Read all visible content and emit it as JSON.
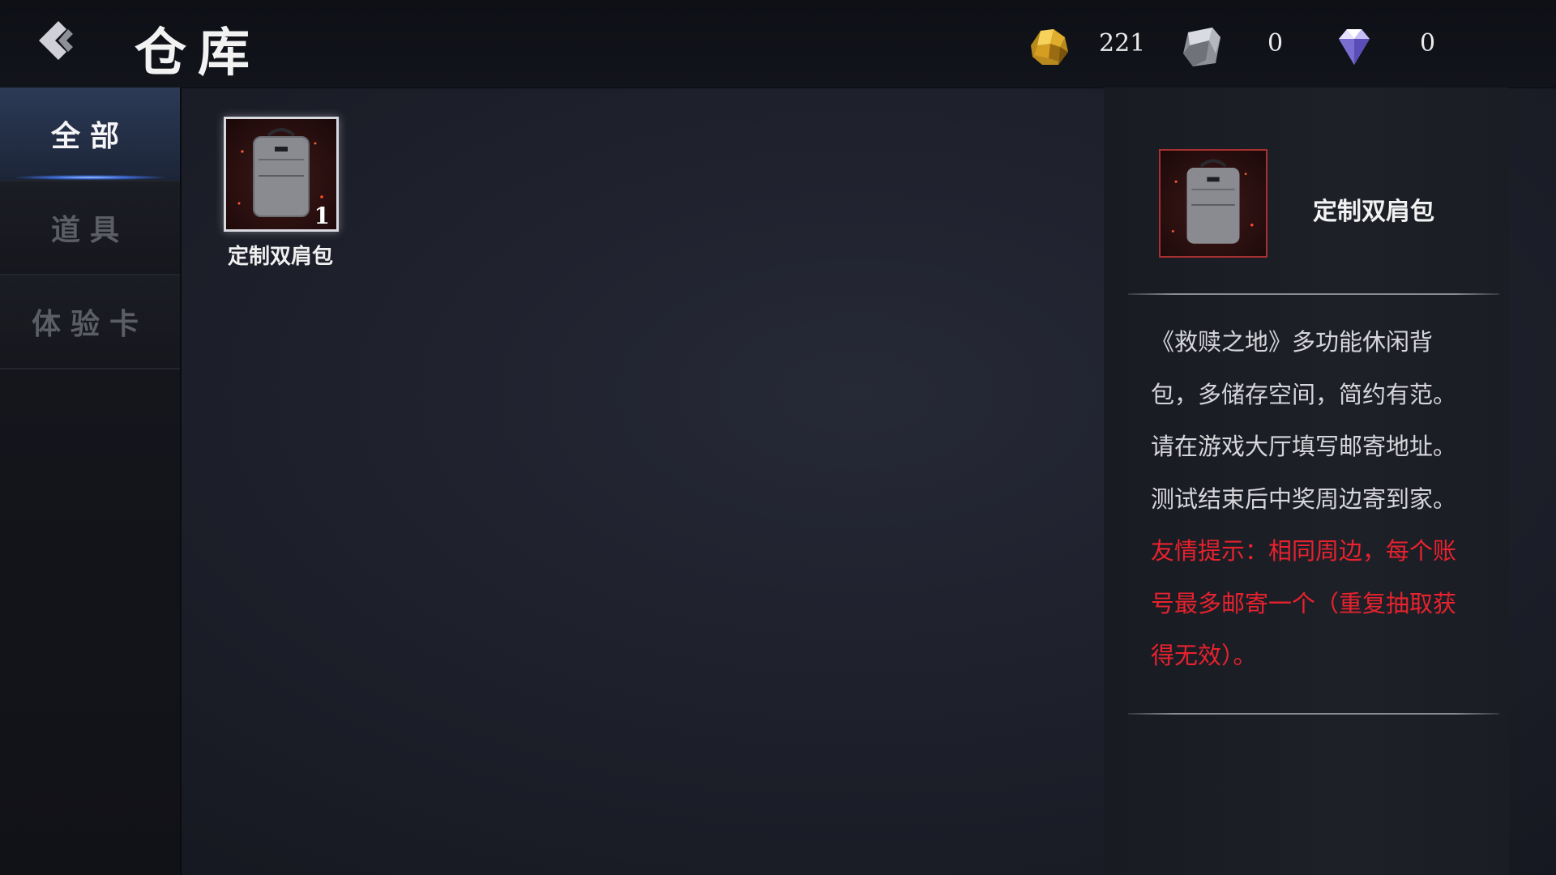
{
  "header": {
    "title": "仓库",
    "currencies": [
      {
        "icon": "gold-ore-icon",
        "value": "221"
      },
      {
        "icon": "silver-ore-icon",
        "value": "0"
      },
      {
        "icon": "diamond-icon",
        "value": "0"
      }
    ]
  },
  "sidebar": {
    "tabs": [
      {
        "label": "全部",
        "active": true
      },
      {
        "label": "道具",
        "active": false
      },
      {
        "label": "体验卡",
        "active": false
      }
    ]
  },
  "inventory": {
    "items": [
      {
        "name": "定制双肩包",
        "count": "1",
        "icon": "backpack-icon"
      }
    ]
  },
  "detail": {
    "name": "定制双肩包",
    "description": "《救赎之地》多功能休闲背包，多储存空间，简约有范。请在游戏大厅填写邮寄地址。测试结束后中奖周边寄到家。",
    "warning": "友情提示：相同周边，每个账号最多邮寄一个（重复抽取获得无效）。"
  },
  "colors": {
    "accent_blue": "#2c3a56",
    "warning_red": "#e8222e",
    "item_frame_red": "#a83030"
  }
}
